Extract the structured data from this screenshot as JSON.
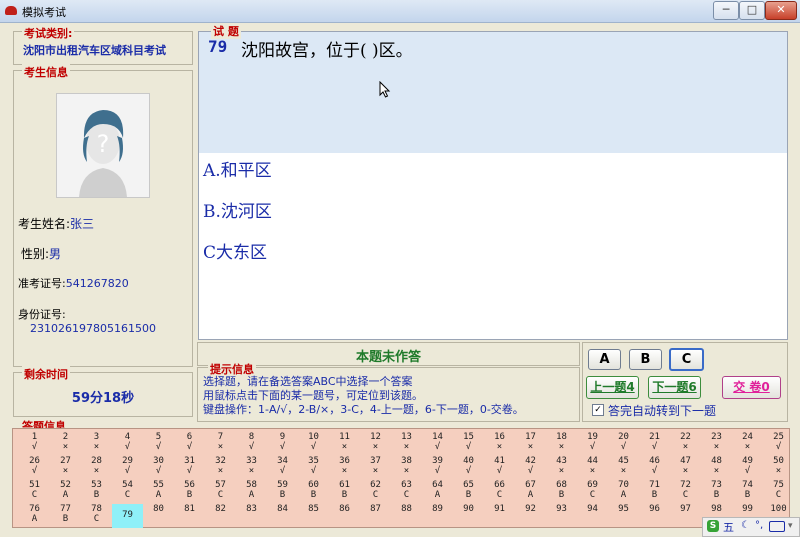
{
  "window": {
    "title": "模拟考试",
    "min": "─",
    "max": "□",
    "close": "✕"
  },
  "exam_type": {
    "label": "考试类别:",
    "value": "沈阳市出租汽车区域科目考试"
  },
  "candidate": {
    "section_label": "考生信息",
    "name_label": "考生姓名:",
    "name": "张三",
    "gender_label": "性别:",
    "gender": "男",
    "ticket_label": "准考证号:",
    "ticket": "541267820",
    "id_label": "身份证号:",
    "id": "231026197805161500"
  },
  "timer": {
    "label": "剩余时间",
    "value": "59分18秒"
  },
  "question": {
    "section_label": "试 题",
    "number": "79",
    "text": "沈阳故宫，位于(  )区。",
    "options": [
      "A.和平区",
      "B.沈河区",
      "C大东区"
    ]
  },
  "status": {
    "text": "本题未作答"
  },
  "hint": {
    "label": "提示信息",
    "lines": [
      "选择题，请在备选答案ABC中选择一个答案",
      "用鼠标点击下面的某一题号，可定位到该题。",
      "键盘操作：1-A/√，2-B/×，3-C，4-上一题，6-下一题，0-交卷。"
    ]
  },
  "controls": {
    "a": "A",
    "b": "B",
    "c": "C",
    "prev": "上一题4",
    "next": "下一题6",
    "submit": "交 卷0",
    "auto_next_label": "答完自动转到下一题",
    "auto_next_checked": true
  },
  "answers": {
    "label": "答题信息",
    "current": 79,
    "rows": [
      [
        [
          "1",
          "√"
        ],
        [
          "2",
          "×"
        ],
        [
          "3",
          "×"
        ],
        [
          "4",
          "√"
        ],
        [
          "5",
          "√"
        ],
        [
          "6",
          "√"
        ],
        [
          "7",
          "×"
        ],
        [
          "8",
          "√"
        ],
        [
          "9",
          "√"
        ],
        [
          "10",
          "√"
        ],
        [
          "11",
          "×"
        ],
        [
          "12",
          "×"
        ],
        [
          "13",
          "×"
        ],
        [
          "14",
          "√"
        ],
        [
          "15",
          "√"
        ],
        [
          "16",
          "×"
        ],
        [
          "17",
          "×"
        ],
        [
          "18",
          "×"
        ],
        [
          "19",
          "√"
        ],
        [
          "20",
          "√"
        ],
        [
          "21",
          "√"
        ],
        [
          "22",
          "×"
        ],
        [
          "23",
          "×"
        ],
        [
          "24",
          "×"
        ],
        [
          "25",
          "√"
        ]
      ],
      [
        [
          "26",
          "√"
        ],
        [
          "27",
          "×"
        ],
        [
          "28",
          "×"
        ],
        [
          "29",
          "√"
        ],
        [
          "30",
          "√"
        ],
        [
          "31",
          "√"
        ],
        [
          "32",
          "×"
        ],
        [
          "33",
          "×"
        ],
        [
          "34",
          "√"
        ],
        [
          "35",
          "√"
        ],
        [
          "36",
          "×"
        ],
        [
          "37",
          "×"
        ],
        [
          "38",
          "×"
        ],
        [
          "39",
          "√"
        ],
        [
          "40",
          "√"
        ],
        [
          "41",
          "√"
        ],
        [
          "42",
          "√"
        ],
        [
          "43",
          "×"
        ],
        [
          "44",
          "×"
        ],
        [
          "45",
          "×"
        ],
        [
          "46",
          "√"
        ],
        [
          "47",
          "×"
        ],
        [
          "48",
          "×"
        ],
        [
          "49",
          "√"
        ],
        [
          "50",
          "×"
        ]
      ],
      [
        [
          "51",
          "C"
        ],
        [
          "52",
          "A"
        ],
        [
          "53",
          "B"
        ],
        [
          "54",
          "C"
        ],
        [
          "55",
          "A"
        ],
        [
          "56",
          "B"
        ],
        [
          "57",
          "C"
        ],
        [
          "58",
          "A"
        ],
        [
          "59",
          "B"
        ],
        [
          "60",
          "B"
        ],
        [
          "61",
          "B"
        ],
        [
          "62",
          "C"
        ],
        [
          "63",
          "C"
        ],
        [
          "64",
          "A"
        ],
        [
          "65",
          "B"
        ],
        [
          "66",
          "C"
        ],
        [
          "67",
          "A"
        ],
        [
          "68",
          "B"
        ],
        [
          "69",
          "C"
        ],
        [
          "70",
          "A"
        ],
        [
          "71",
          "B"
        ],
        [
          "72",
          "C"
        ],
        [
          "73",
          "B"
        ],
        [
          "74",
          "B"
        ],
        [
          "75",
          "C"
        ]
      ],
      [
        [
          "76",
          "A"
        ],
        [
          "77",
          "B"
        ],
        [
          "78",
          "C"
        ],
        [
          "79",
          ""
        ],
        [
          "80",
          ""
        ],
        [
          "81",
          ""
        ],
        [
          "82",
          ""
        ],
        [
          "83",
          ""
        ],
        [
          "84",
          ""
        ],
        [
          "85",
          ""
        ],
        [
          "86",
          ""
        ],
        [
          "87",
          ""
        ],
        [
          "88",
          ""
        ],
        [
          "89",
          ""
        ],
        [
          "90",
          ""
        ],
        [
          "91",
          ""
        ],
        [
          "92",
          ""
        ],
        [
          "93",
          ""
        ],
        [
          "94",
          ""
        ],
        [
          "95",
          ""
        ],
        [
          "96",
          ""
        ],
        [
          "97",
          ""
        ],
        [
          "98",
          ""
        ],
        [
          "99",
          ""
        ],
        [
          "100",
          ""
        ]
      ]
    ]
  },
  "tray": {
    "ime": "S",
    "lang": "五"
  }
}
